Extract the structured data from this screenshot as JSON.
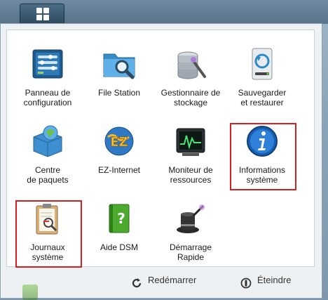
{
  "colors": {
    "highlight": "#d61f1f",
    "panel_bg": "#eef1f3"
  },
  "apps": [
    {
      "name": "app-panneau-de-configuration",
      "icon": "control-panel-icon",
      "label": "Panneau de\nconfiguration"
    },
    {
      "name": "app-file-station",
      "icon": "file-station-folder-icon",
      "label": "File Station"
    },
    {
      "name": "app-gestionnaire-de-stockage",
      "icon": "storage-manager-icon",
      "label": "Gestionnaire de\nstockage"
    },
    {
      "name": "app-sauvegarder-et-restaurer",
      "icon": "backup-restore-icon",
      "label": "Sauvegarder\net restaurer"
    },
    {
      "name": "app-centre-de-paquets",
      "icon": "package-center-icon",
      "label": "Centre\nde paquets"
    },
    {
      "name": "app-ez-internet",
      "icon": "ez-internet-icon",
      "label": "EZ-Internet"
    },
    {
      "name": "app-moniteur-de-ressources",
      "icon": "resource-monitor-icon",
      "label": "Moniteur de\nressources"
    },
    {
      "name": "app-informations-systeme",
      "icon": "info-icon",
      "label": "Informations\nsystème",
      "highlighted": true
    },
    {
      "name": "app-journaux-systeme",
      "icon": "system-logs-icon",
      "label": "Journaux\nsystème",
      "highlighted": true
    },
    {
      "name": "app-aide-dsm",
      "icon": "help-book-icon",
      "label": "Aide DSM"
    },
    {
      "name": "app-demarrage-rapide",
      "icon": "magic-hat-icon",
      "label": "Démarrage\nRapide"
    }
  ],
  "footer": {
    "restart_label": "Redémarrer",
    "shutdown_label": "Éteindre"
  }
}
